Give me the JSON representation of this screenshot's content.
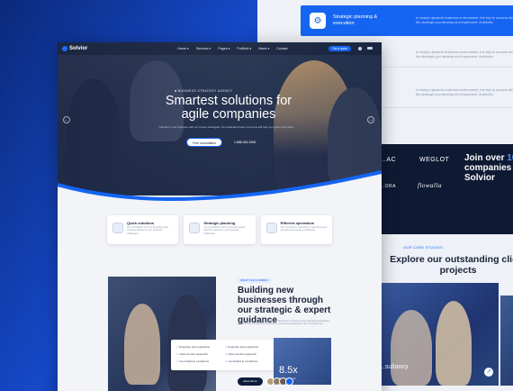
{
  "back": {
    "services": [
      {
        "title": "Strategic planning & execution",
        "desc": "In today's dynamic business environment, the key to success lies the strategic you develop and implement. Authentic",
        "active": true
      },
      {
        "title": "",
        "desc": "In today's dynamic business environment, the key to success lies the strategic you develop and implement. Authentic",
        "active": false
      },
      {
        "title": "",
        "desc": "In today's dynamic business environment, the key to success lies the strategic you develop and implement. Authentic",
        "active": false
      }
    ],
    "clients": {
      "logos": [
        "...AC",
        "WEGLOT",
        "...ORA",
        "flowalla"
      ],
      "join_line1": "Join over ",
      "join_highlight": "100",
      "join_line2": "companies w",
      "join_line3": "Solvior"
    },
    "projects": {
      "tag": "OUR CASE STUDIES",
      "title": "Explore our outstanding client projects",
      "caption": "...sultancy",
      "arrow": "↗"
    }
  },
  "front": {
    "brand": "Solvior",
    "menu": [
      "Home ▾",
      "Services ▾",
      "Pages ▾",
      "Portfolio ▾",
      "News ▾",
      "Contact"
    ],
    "nav_cta": "Get a quote",
    "hero": {
      "eyebrow": "■ BUSINESS STRATEGY AGENCY",
      "title": "Smartest solutions for agile companies",
      "subtitle": "Transform your business with our proven strategies. Our dedicated team of experts will help you grow your brand",
      "button": "Free consultation",
      "phone": "1-888-452-1505",
      "prev": "←",
      "next": "→"
    },
    "features": [
      {
        "title": "Quick solutions",
        "desc": "Our consultants work on providing quick solutions tailored to your business challenges"
      },
      {
        "title": "Strategic planning",
        "desc": "Our consultants work on providing quick solutions tailored to your business challenges"
      },
      {
        "title": "Efficient operations",
        "desc": "Our consultancy specialize in optimizing your operational processes, identifying"
      }
    ],
    "about": {
      "tag": "ABOUT OUR COMPANY",
      "title": "Building new businesses through our strategic & expert guidance",
      "desc": "Our mission is to empower businesses off all size to thrive an ever-changing marketplace. In Solvior we are business consultants, and we are dedicated to the companies we",
      "checks": [
        "Expertise and experience",
        "Client-Centric approach",
        "Committed to excellence",
        "Expertise and experience",
        "Client-Centric approach",
        "Committed to excellence"
      ],
      "stat_value": "8.5x",
      "stat_caption": "Business growth",
      "button": "About More"
    }
  },
  "colors": {
    "accent": "#1565f2",
    "dark": "#0e1b3a",
    "bg": "#0b2f86"
  }
}
